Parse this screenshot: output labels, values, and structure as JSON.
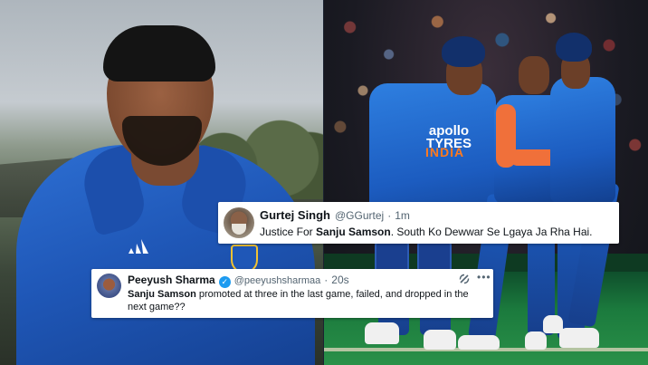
{
  "tweet_1": {
    "display_name": "Gurtej Singh",
    "handle": "@GGurtej",
    "separator": "·",
    "time": "1m",
    "text_prefix": "Justice For ",
    "text_bold": "Sanju Samson",
    "text_suffix": ". South Ko Dewwar Se Lgaya Ja Rha Hai.",
    "avatar_icon": "user-avatar"
  },
  "tweet_2": {
    "display_name": "Peeyush Sharma",
    "verified": true,
    "handle": "@peeyushsharmaa",
    "separator": "·",
    "time": "20s",
    "text_bold": "Sanju Samson",
    "text_suffix": " promoted at three in the last game, failed, and dropped in the next game??",
    "avatar_icon": "user-avatar",
    "action_icons": [
      "grok-icon",
      "more-icon"
    ]
  },
  "photos": {
    "left_jersey_brand": "adidas",
    "right_sponsor": "apollo TYRES",
    "right_team_text": "INDIA"
  },
  "colors": {
    "jersey_blue": "#1f57b7",
    "verified_blue": "#1d9bf0",
    "accent_orange": "#ff7a1f"
  }
}
